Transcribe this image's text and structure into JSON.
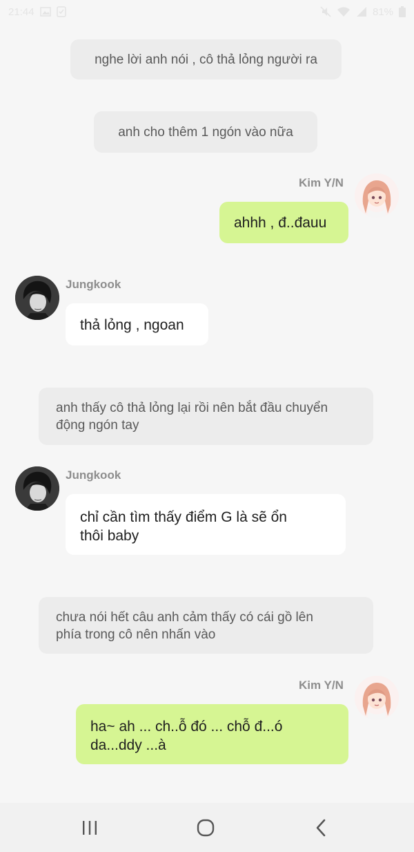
{
  "status_bar": {
    "time": "21:44",
    "battery": "81%",
    "icons": [
      "gallery-icon",
      "notification-icon",
      "mute-icon",
      "wifi-icon",
      "signal-icon",
      "battery-icon"
    ]
  },
  "messages": [
    {
      "kind": "narration",
      "text": "nghe lời anh nói , cô thả lỏng người ra"
    },
    {
      "kind": "narration",
      "text": "anh cho thêm 1 ngón vào nữa"
    },
    {
      "kind": "sent",
      "sender": "Kim Y/N",
      "text": "ahhh , đ..đauu"
    },
    {
      "kind": "received",
      "sender": "Jungkook",
      "text": "thả lỏng , ngoan"
    },
    {
      "kind": "narration",
      "lines": [
        "anh thấy cô thả lỏng lại rồi nên bắt đầu chuyển",
        "động ngón tay"
      ]
    },
    {
      "kind": "received",
      "sender": "Jungkook",
      "lines": [
        "chỉ cần tìm thấy điểm G là sẽ ổn",
        "thôi baby"
      ]
    },
    {
      "kind": "narration",
      "lines": [
        "chưa nói hết câu anh cảm thấy có cái gồ lên",
        "phía trong cô nên nhấn vào"
      ]
    },
    {
      "kind": "sent",
      "sender": "Kim Y/N",
      "lines": [
        "ha~ ah ... ch..ỗ đó ... chỗ đ...ó",
        "da...ddy ...à"
      ]
    }
  ],
  "nav_bar": {
    "icons": [
      "recent-apps-icon",
      "home-icon",
      "back-icon"
    ]
  },
  "colors": {
    "sent_bubble": "#d6f593",
    "received_bubble": "#ffffff",
    "narration_bubble": "#ececec",
    "background": "#f6f6f6"
  }
}
